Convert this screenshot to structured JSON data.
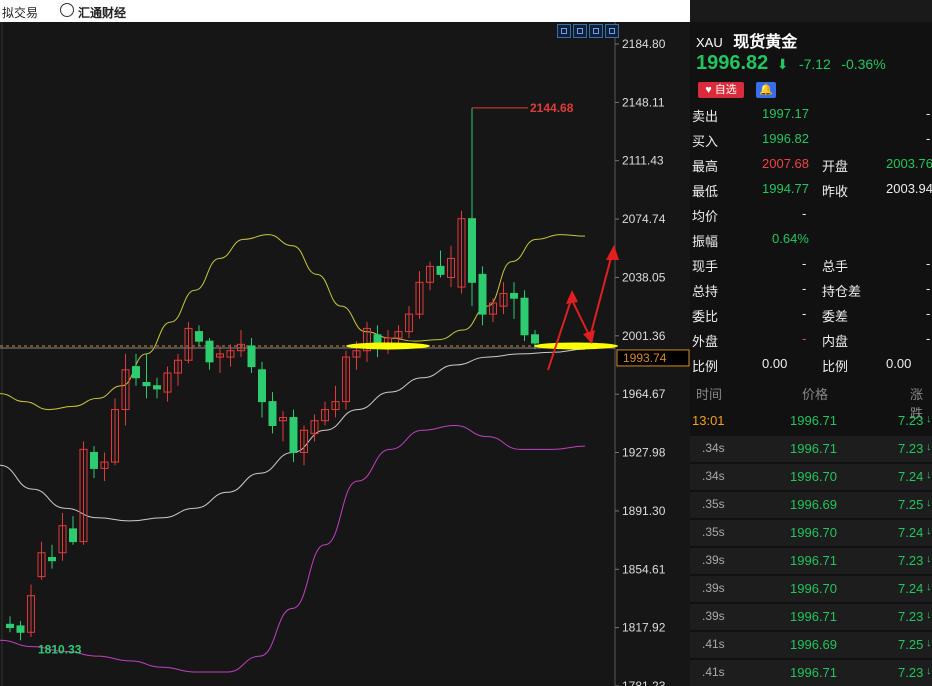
{
  "topbar": {
    "tab1": "拟交易",
    "tab2": "汇通财经"
  },
  "chart": {
    "price_axis": [
      "2184.80",
      "2148.11",
      "2111.43",
      "2074.74",
      "2038.05",
      "2001.36",
      "1964.67",
      "1927.98",
      "1891.30",
      "1854.61",
      "1817.92",
      "1781.23"
    ],
    "current_price_label": "1993.74",
    "high_label": "2144.68",
    "low_label": "1810.33"
  },
  "chart_data": {
    "type": "candlestick",
    "ylim": [
      1781.23,
      2184.8
    ],
    "candles": [
      {
        "o": 1820,
        "h": 1825,
        "l": 1815,
        "c": 1818
      },
      {
        "o": 1819,
        "h": 1822,
        "l": 1810,
        "c": 1815
      },
      {
        "o": 1815,
        "h": 1845,
        "l": 1812,
        "c": 1838
      },
      {
        "o": 1850,
        "h": 1872,
        "l": 1848,
        "c": 1865
      },
      {
        "o": 1862,
        "h": 1870,
        "l": 1855,
        "c": 1860
      },
      {
        "o": 1865,
        "h": 1890,
        "l": 1860,
        "c": 1882
      },
      {
        "o": 1880,
        "h": 1888,
        "l": 1870,
        "c": 1872
      },
      {
        "o": 1872,
        "h": 1935,
        "l": 1870,
        "c": 1930
      },
      {
        "o": 1928,
        "h": 1932,
        "l": 1912,
        "c": 1918
      },
      {
        "o": 1918,
        "h": 1928,
        "l": 1910,
        "c": 1922
      },
      {
        "o": 1922,
        "h": 1962,
        "l": 1920,
        "c": 1955
      },
      {
        "o": 1955,
        "h": 1990,
        "l": 1945,
        "c": 1980
      },
      {
        "o": 1982,
        "h": 1990,
        "l": 1970,
        "c": 1975
      },
      {
        "o": 1972,
        "h": 1990,
        "l": 1962,
        "c": 1970
      },
      {
        "o": 1970,
        "h": 1975,
        "l": 1962,
        "c": 1968
      },
      {
        "o": 1966,
        "h": 1982,
        "l": 1960,
        "c": 1978
      },
      {
        "o": 1978,
        "h": 1990,
        "l": 1970,
        "c": 1986
      },
      {
        "o": 1986,
        "h": 2010,
        "l": 1984,
        "c": 2006
      },
      {
        "o": 2004,
        "h": 2008,
        "l": 1995,
        "c": 1998
      },
      {
        "o": 1998,
        "h": 2000,
        "l": 1980,
        "c": 1985
      },
      {
        "o": 1988,
        "h": 1995,
        "l": 1978,
        "c": 1990
      },
      {
        "o": 1988,
        "h": 1996,
        "l": 1982,
        "c": 1992
      },
      {
        "o": 1992,
        "h": 2005,
        "l": 1988,
        "c": 1996
      },
      {
        "o": 1995,
        "h": 2000,
        "l": 1978,
        "c": 1982
      },
      {
        "o": 1980,
        "h": 1985,
        "l": 1950,
        "c": 1960
      },
      {
        "o": 1960,
        "h": 1966,
        "l": 1940,
        "c": 1945
      },
      {
        "o": 1948,
        "h": 1954,
        "l": 1935,
        "c": 1950
      },
      {
        "o": 1950,
        "h": 1955,
        "l": 1922,
        "c": 1928
      },
      {
        "o": 1928,
        "h": 1945,
        "l": 1920,
        "c": 1942
      },
      {
        "o": 1940,
        "h": 1952,
        "l": 1935,
        "c": 1948
      },
      {
        "o": 1948,
        "h": 1960,
        "l": 1945,
        "c": 1955
      },
      {
        "o": 1955,
        "h": 1970,
        "l": 1950,
        "c": 1960
      },
      {
        "o": 1960,
        "h": 1992,
        "l": 1955,
        "c": 1988
      },
      {
        "o": 1988,
        "h": 1998,
        "l": 1980,
        "c": 1992
      },
      {
        "o": 1992,
        "h": 2010,
        "l": 1985,
        "c": 2006
      },
      {
        "o": 2002,
        "h": 2008,
        "l": 1988,
        "c": 1995
      },
      {
        "o": 1996,
        "h": 2005,
        "l": 1990,
        "c": 2000
      },
      {
        "o": 2000,
        "h": 2008,
        "l": 1994,
        "c": 2004
      },
      {
        "o": 2004,
        "h": 2020,
        "l": 2000,
        "c": 2015
      },
      {
        "o": 2015,
        "h": 2042,
        "l": 2012,
        "c": 2035
      },
      {
        "o": 2035,
        "h": 2048,
        "l": 2030,
        "c": 2045
      },
      {
        "o": 2045,
        "h": 2055,
        "l": 2038,
        "c": 2040
      },
      {
        "o": 2038,
        "h": 2058,
        "l": 2032,
        "c": 2050
      },
      {
        "o": 2032,
        "h": 2080,
        "l": 2028,
        "c": 2075
      },
      {
        "o": 2075,
        "h": 2144.68,
        "l": 2020,
        "c": 2035
      },
      {
        "o": 2040,
        "h": 2045,
        "l": 2008,
        "c": 2015
      },
      {
        "o": 2015,
        "h": 2025,
        "l": 2010,
        "c": 2022
      },
      {
        "o": 2020,
        "h": 2035,
        "l": 2015,
        "c": 2028
      },
      {
        "o": 2028,
        "h": 2035,
        "l": 2012,
        "c": 2025
      },
      {
        "o": 2025,
        "h": 2030,
        "l": 1998,
        "c": 2002
      },
      {
        "o": 2002,
        "h": 2005,
        "l": 1993,
        "c": 1996.82
      }
    ],
    "ma_colors": {
      "bb_upper": "#c8c83a",
      "bb_mid": "#cccccc",
      "bb_lower": "#c040c0"
    }
  },
  "panel": {
    "code": "XAU",
    "name": "现货黄金",
    "price": "1996.82",
    "change": "-7.12",
    "change_pct": "-0.36%",
    "fav_label": "自选",
    "quotes": [
      {
        "label": "卖出",
        "value": "1997.17",
        "color": "green",
        "label2": "",
        "value2": "-"
      },
      {
        "label": "买入",
        "value": "1996.82",
        "color": "green",
        "label2": "",
        "value2": "-"
      },
      {
        "label": "最高",
        "value": "2007.68",
        "color": "red",
        "label2": "开盘",
        "value2": "2003.76"
      },
      {
        "label": "最低",
        "value": "1994.77",
        "color": "green",
        "label2": "昨收",
        "value2": "2003.94"
      },
      {
        "label": "均价",
        "value": "-",
        "color": "white",
        "label2": "",
        "value2": ""
      },
      {
        "label": "振幅",
        "value": "0.64%",
        "color": "green",
        "label2": "",
        "value2": ""
      },
      {
        "label": "现手",
        "value": "-",
        "color": "white",
        "label2": "总手",
        "value2": "-"
      },
      {
        "label": "总持",
        "value": "-",
        "color": "white",
        "label2": "持仓差",
        "value2": "-"
      },
      {
        "label": "委比",
        "value": "-",
        "color": "white",
        "label2": "委差",
        "value2": "-"
      },
      {
        "label": "外盘",
        "value": "-",
        "color": "red",
        "label2": "内盘",
        "value2": "-"
      },
      {
        "label": "比例",
        "value": "0.00",
        "color": "white",
        "label2": "比例",
        "value2": "0.00"
      }
    ],
    "trade_headers": {
      "time": "时间",
      "price": "价格",
      "change": "涨跌"
    },
    "trades": [
      {
        "time": "13:01",
        "price": "1996.71",
        "val": "7.23"
      },
      {
        "time": ".34s",
        "price": "1996.71",
        "val": "7.23"
      },
      {
        "time": ".34s",
        "price": "1996.70",
        "val": "7.24"
      },
      {
        "time": ".35s",
        "price": "1996.69",
        "val": "7.25"
      },
      {
        "time": ".35s",
        "price": "1996.70",
        "val": "7.24"
      },
      {
        "time": ".39s",
        "price": "1996.71",
        "val": "7.23"
      },
      {
        "time": ".39s",
        "price": "1996.70",
        "val": "7.24"
      },
      {
        "time": ".39s",
        "price": "1996.71",
        "val": "7.23"
      },
      {
        "time": ".41s",
        "price": "1996.69",
        "val": "7.25"
      },
      {
        "time": ".41s",
        "price": "1996.71",
        "val": "7.23"
      }
    ]
  }
}
